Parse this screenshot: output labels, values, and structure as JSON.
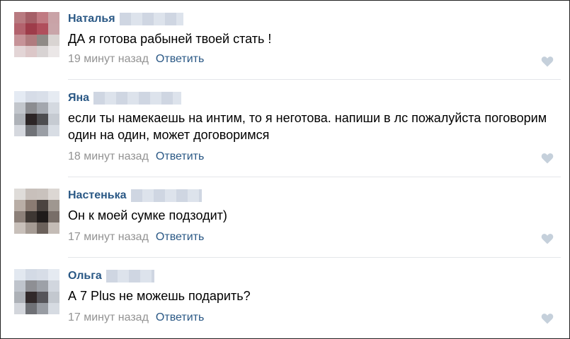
{
  "comments": [
    {
      "author": "Наталья",
      "text": "ДА я готова рабыней твоей стать !",
      "time": "19 минут назад",
      "reply": "Ответить",
      "like_icon": "heart-icon",
      "avatar_palette": [
        "#b87a80",
        "#a55f67",
        "#c07a82",
        "#c9a3a7",
        "#b3626d",
        "#9e3c4a",
        "#b04f5c",
        "#c9a5a9",
        "#c69398",
        "#b07b7e",
        "#8f8a86",
        "#d9d4d2",
        "#e3d5d6",
        "#dcc7c8",
        "#d8d3d3",
        "#ebe7e7"
      ]
    },
    {
      "author": "Яна",
      "text": "если ты намекаешь на интим, то я неготова. напиши в лс пожалуйста поговорим один на один, может договоримся",
      "time": "18 минут назад",
      "reply": "Ответить",
      "like_icon": "heart-icon",
      "avatar_palette": [
        "#e4eaf3",
        "#d6dce7",
        "#d9dfe9",
        "#e6ebf2",
        "#c2c6cc",
        "#8c8d91",
        "#a3a7ae",
        "#d4d9e0",
        "#aeb2b8",
        "#2c2526",
        "#4d4d50",
        "#c6cbd2",
        "#d5d8de",
        "#707277",
        "#9a9ea5",
        "#d8dde4"
      ]
    },
    {
      "author": "Настенька",
      "text": "Он к моей сумке подзодит)",
      "time": "17 минут назад",
      "reply": "Ответить",
      "like_icon": "heart-icon",
      "avatar_palette": [
        "#dfdcd9",
        "#c8c0bb",
        "#c9c2bd",
        "#dcd7d3",
        "#b9aea6",
        "#8b7c73",
        "#4b4440",
        "#9f9790",
        "#8c8079",
        "#3e3733",
        "#1f1b1a",
        "#786e68",
        "#c8c0ba",
        "#a59b94",
        "#6b615b",
        "#c4bcb6"
      ]
    },
    {
      "author": "Ольга",
      "text": "А 7 Plus не можешь подарить?",
      "time": "17 минут назад",
      "reply": "Ответить",
      "like_icon": "heart-icon",
      "avatar_palette": [
        "#e2e8f0",
        "#d3dae5",
        "#d7dde7",
        "#e5eaf1",
        "#bfc4cc",
        "#8e8f94",
        "#9da1a8",
        "#d1d6de",
        "#adb1b7",
        "#31292a",
        "#56555a",
        "#c3c8cf",
        "#d3d6dc",
        "#6f7176",
        "#989ca3",
        "#d6dbe2"
      ]
    }
  ],
  "colors": {
    "link": "#2a5885",
    "meta": "#939393",
    "text": "#000000",
    "divider": "#e4e6ea",
    "heart": "#c5d0db"
  }
}
